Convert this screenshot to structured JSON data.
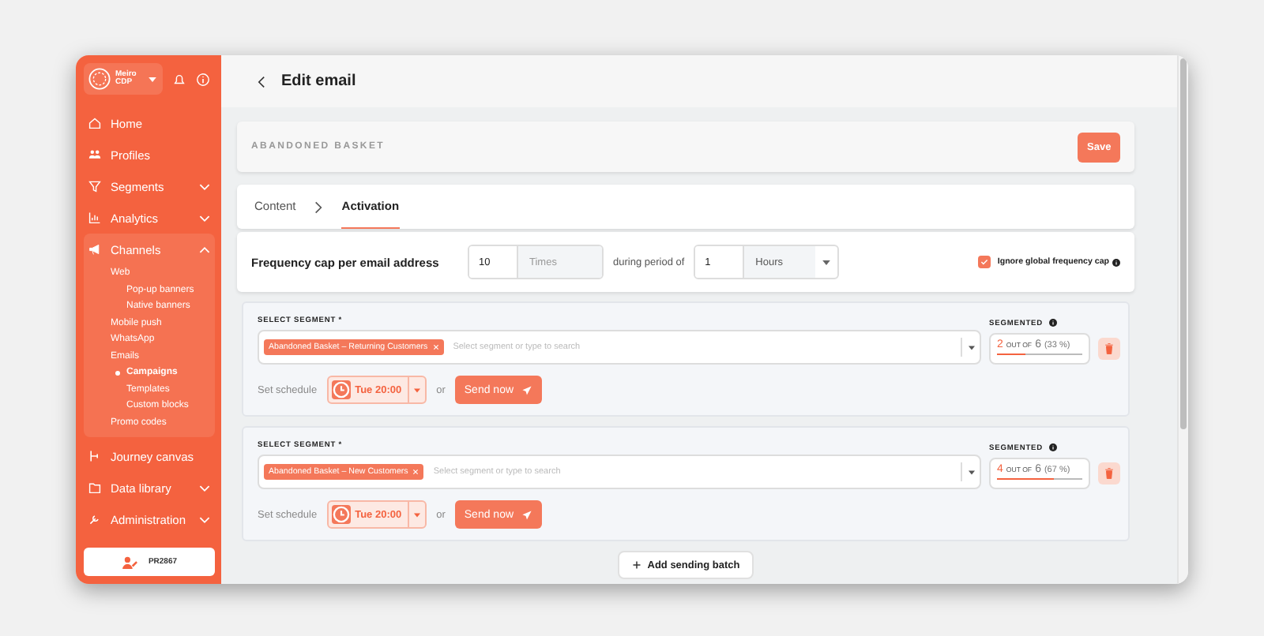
{
  "sidebar": {
    "logo": "Meiro CDP",
    "items": [
      {
        "label": "Home"
      },
      {
        "label": "Profiles"
      },
      {
        "label": "Segments",
        "expanded": false,
        "expandable": true
      },
      {
        "label": "Analytics",
        "expanded": false,
        "expandable": true
      },
      {
        "label": "Channels",
        "expanded": true,
        "expandable": true,
        "children": [
          {
            "label": "Web",
            "selected": false,
            "children": [
              {
                "label": "Pop-up banners",
                "selected": false
              },
              {
                "label": "Native banners",
                "selected": false
              }
            ]
          },
          {
            "label": "Mobile push",
            "selected": false
          },
          {
            "label": "WhatsApp",
            "selected": false
          },
          {
            "label": "Emails",
            "selected": false,
            "children": [
              {
                "label": "Campaigns",
                "selected": true
              },
              {
                "label": "Templates",
                "selected": false
              },
              {
                "label": "Custom blocks",
                "selected": false
              }
            ]
          },
          {
            "label": "Promo codes",
            "selected": false
          }
        ]
      },
      {
        "label": "Journey canvas"
      },
      {
        "label": "Data library",
        "expanded": false,
        "expandable": true
      },
      {
        "label": "Administration",
        "expanded": false,
        "expandable": true
      }
    ],
    "user": "PR2867"
  },
  "header": {
    "title": "Edit email"
  },
  "campaign": {
    "name": "ABANDONED BASKET",
    "save": "Save"
  },
  "tabs": [
    {
      "label": "Content",
      "selected": false
    },
    {
      "label": "Activation",
      "selected": true
    }
  ],
  "frequency": {
    "label": "Frequency cap per email address",
    "count": "10",
    "count_unit": "Times",
    "during": "during period of",
    "period": "1",
    "period_unit": "Hours",
    "ignore_label": "Ignore global frequency cap",
    "ignore_checked": true
  },
  "batches": [
    {
      "segment_label": "SELECT SEGMENT *",
      "tag": "Abandoned Basket – Returning Customers",
      "placeholder": "Select segment or type to search",
      "segmented_label": "SEGMENTED",
      "count": "2",
      "out_of": "OUT OF",
      "total": "6",
      "percent": "(33 %)",
      "level": 0.33,
      "schedule_label": "Set schedule",
      "time": "Tue 20:00",
      "or": "or",
      "send": "Send now"
    },
    {
      "segment_label": "SELECT SEGMENT *",
      "tag": "Abandoned Basket – New Customers",
      "placeholder": "Select segment or type to search",
      "segmented_label": "SEGMENTED",
      "count": "4",
      "out_of": "OUT OF",
      "total": "6",
      "percent": "(67 %)",
      "level": 0.67,
      "schedule_label": "Set schedule",
      "time": "Tue 20:00",
      "or": "or",
      "send": "Send now"
    }
  ],
  "add_batch": "Add sending batch"
}
